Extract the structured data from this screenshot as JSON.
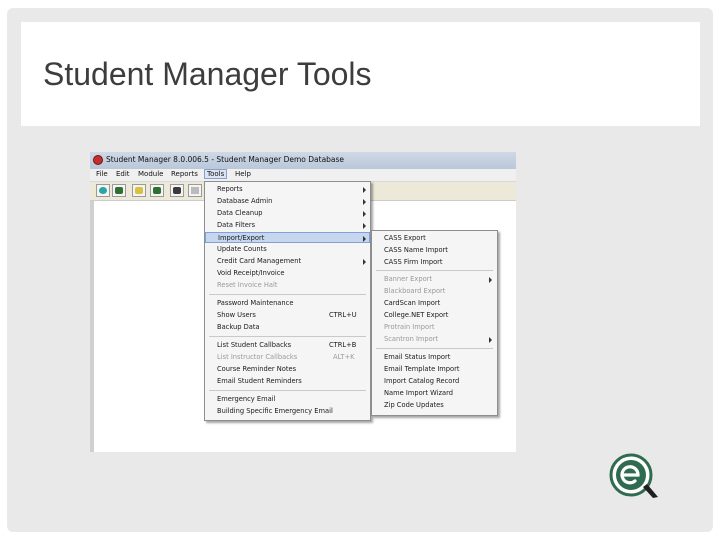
{
  "slide": {
    "title": "Student Manager Tools"
  },
  "window": {
    "title": "Student Manager 8.0.006.5 - Student Manager Demo Database"
  },
  "menubar": [
    "File",
    "Edit",
    "Module",
    "Reports",
    "Tools",
    "Help"
  ],
  "tools_menu": {
    "items": [
      {
        "label": "Reports",
        "submenu": true
      },
      {
        "label": "Database Admin",
        "submenu": true
      },
      {
        "label": "Data Cleanup",
        "submenu": true
      },
      {
        "label": "Data Filters",
        "submenu": true
      },
      {
        "label": "Import/Export",
        "submenu": true,
        "highlighted": true
      },
      {
        "label": "Update Counts"
      },
      {
        "label": "Credit Card Management",
        "submenu": true
      },
      {
        "label": "Void Receipt/Invoice"
      },
      {
        "label": "Reset Invoice Halt",
        "disabled": true
      },
      {
        "label": "Password Maintenance"
      },
      {
        "label": "Show Users",
        "shortcut": "CTRL+U"
      },
      {
        "label": "Backup Data"
      },
      {
        "label": "List Student Callbacks",
        "shortcut": "CTRL+B"
      },
      {
        "label": "List Instructor Callbacks",
        "shortcut": "ALT+K",
        "disabled": true
      },
      {
        "label": "Course Reminder Notes"
      },
      {
        "label": "Email Student Reminders"
      },
      {
        "label": "Emergency Email"
      },
      {
        "label": "Building Specific Emergency Email"
      }
    ]
  },
  "import_export_menu": {
    "items": [
      {
        "label": "CASS Export"
      },
      {
        "label": "CASS Name Import"
      },
      {
        "label": "CASS Firm Import"
      },
      {
        "label": "Banner Export",
        "submenu": true,
        "disabled": true
      },
      {
        "label": "Blackboard Export",
        "disabled": true
      },
      {
        "label": "CardScan Import"
      },
      {
        "label": "College.NET Export"
      },
      {
        "label": "Protrain Import",
        "disabled": true
      },
      {
        "label": "Scantron Import",
        "submenu": true,
        "disabled": true
      },
      {
        "label": "Email Status Import"
      },
      {
        "label": "Email Template Import"
      },
      {
        "label": "Import Catalog Record"
      },
      {
        "label": "Name Import Wizard"
      },
      {
        "label": "Zip Code Updates"
      }
    ]
  },
  "icons": {
    "toolbar": [
      "gear-icon",
      "binoculars-icon",
      "binoculars-icon",
      "binoculars-icon",
      "binoculars-icon",
      "card-icon"
    ],
    "logo": "e-logo-icon"
  },
  "colors": {
    "menu_highlight": "#c5d6ee",
    "logo_green": "#2f6b4f"
  }
}
